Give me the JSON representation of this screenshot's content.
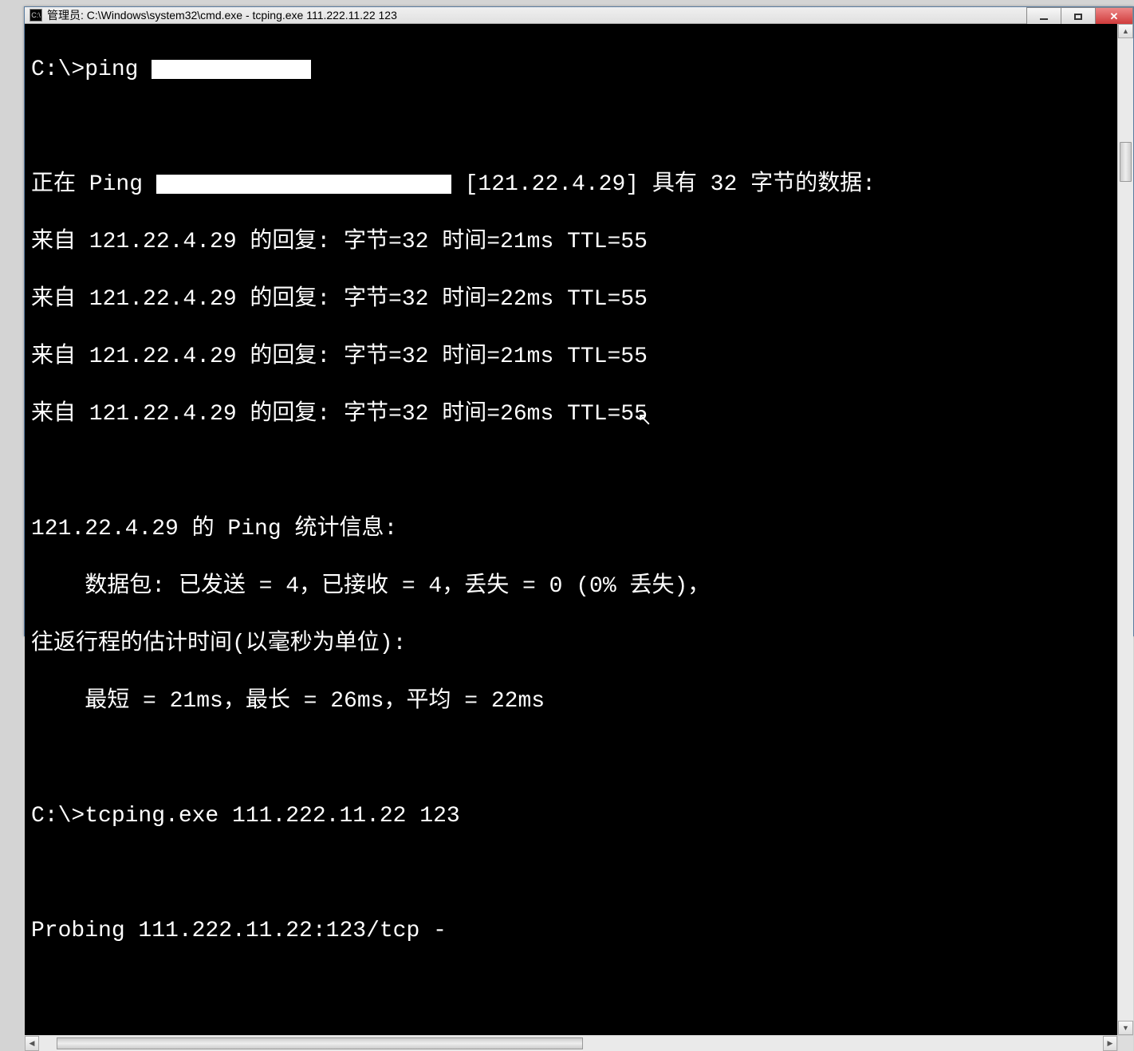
{
  "window": {
    "title": "管理员: C:\\Windows\\system32\\cmd.exe - tcping.exe  111.222.11.22 123",
    "icon_label": "C:\\"
  },
  "terminal": {
    "prompt1_prefix": "C:\\>ping ",
    "ping_header_prefix": "正在 Ping ",
    "ping_header_suffix": " [121.22.4.29] 具有 32 字节的数据:",
    "replies": [
      "来自 121.22.4.29 的回复: 字节=32 时间=21ms TTL=55",
      "来自 121.22.4.29 的回复: 字节=32 时间=22ms TTL=55",
      "来自 121.22.4.29 的回复: 字节=32 时间=21ms TTL=55",
      "来自 121.22.4.29 的回复: 字节=32 时间=26ms TTL=55"
    ],
    "stats_header": "121.22.4.29 的 Ping 统计信息:",
    "stats_packets": "    数据包: 已发送 = 4，已接收 = 4，丢失 = 0 (0% 丢失)，",
    "rtt_header": "往返行程的估计时间(以毫秒为单位):",
    "rtt_values": "    最短 = 21ms，最长 = 26ms，平均 = 22ms",
    "prompt2": "C:\\>tcping.exe 111.222.11.22 123",
    "probing": "Probing 111.222.11.22:123/tcp - "
  }
}
